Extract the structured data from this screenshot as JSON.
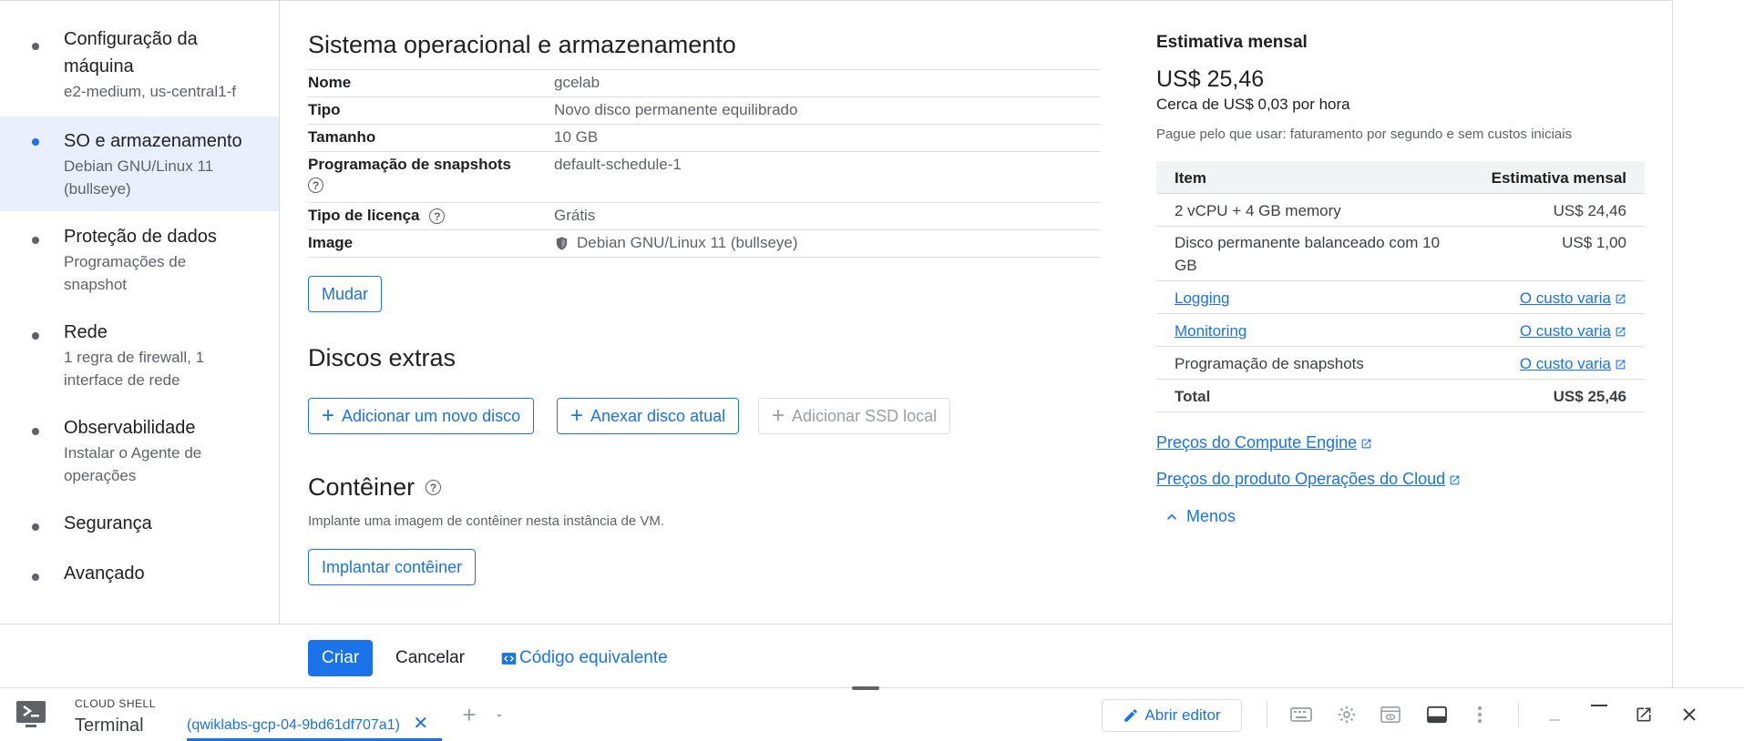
{
  "nav": {
    "items": [
      {
        "title": "Configuração da máquina",
        "sub": "e2-medium, us-central1-f"
      },
      {
        "title": "SO e armazenamento",
        "sub": "Debian GNU/Linux 11 (bullseye)"
      },
      {
        "title": "Proteção de dados",
        "sub": "Programações de snapshot"
      },
      {
        "title": "Rede",
        "sub": "1 regra de firewall, 1 interface de rede"
      },
      {
        "title": "Observabilidade",
        "sub": "Instalar o Agente de operações"
      },
      {
        "title": "Segurança",
        "sub": ""
      },
      {
        "title": "Avançado",
        "sub": ""
      }
    ],
    "active_index": 1
  },
  "os_section": {
    "title": "Sistema operacional e armazenamento",
    "rows": [
      {
        "key": "Nome",
        "value": "gcelab"
      },
      {
        "key": "Tipo",
        "value": "Novo disco permanente equilibrado"
      },
      {
        "key": "Tamanho",
        "value": "10 GB"
      },
      {
        "key": "Programação de snapshots",
        "value": "default-schedule-1"
      },
      {
        "key": "Tipo de licença",
        "value": "Grátis"
      },
      {
        "key": "Image",
        "value": "Debian GNU/Linux 11 (bullseye)"
      }
    ],
    "change_button": "Mudar"
  },
  "disks_section": {
    "title": "Discos extras",
    "add_new": "Adicionar um novo disco",
    "attach_existing": "Anexar disco atual",
    "add_local_ssd": "Adicionar SSD local"
  },
  "container_section": {
    "title": "Contêiner",
    "description": "Implante uma imagem de contêiner nesta instância de VM.",
    "deploy_button": "Implantar contêiner"
  },
  "estimate": {
    "title": "Estimativa mensal",
    "price": "US$ 25,46",
    "hourly": "Cerca de US$ 0,03 por hora",
    "note": "Pague pelo que usar: faturamento por segundo e sem custos iniciais",
    "header": {
      "item": "Item",
      "cost": "Estimativa mensal"
    },
    "rows": [
      {
        "item": "2 vCPU + 4 GB memory",
        "cost": "US$ 24,46",
        "item_link": false,
        "cost_link": false
      },
      {
        "item": "Disco permanente balanceado com 10 GB",
        "cost": "US$ 1,00",
        "item_link": false,
        "cost_link": false
      },
      {
        "item": "Logging",
        "cost": "O custo varia",
        "item_link": true,
        "cost_link": true
      },
      {
        "item": "Monitoring",
        "cost": "O custo varia",
        "item_link": true,
        "cost_link": true
      },
      {
        "item": "Programação de snapshots",
        "cost": "O custo varia",
        "item_link": false,
        "cost_link": true
      }
    ],
    "total": {
      "item": "Total",
      "cost": "US$ 25,46"
    },
    "links": [
      "Preços do Compute Engine",
      "Preços do produto Operações do Cloud"
    ],
    "less": "Menos"
  },
  "footer": {
    "create": "Criar",
    "cancel": "Cancelar",
    "equivalent_code": "Código equivalente"
  },
  "shell": {
    "caption": "CLOUD SHELL",
    "title": "Terminal",
    "tab_label": "(qwiklabs-gcp-04-9bd61df707a1)",
    "open_editor": "Abrir editor"
  },
  "colors": {
    "accent": "#1a73e8",
    "active_nav_bg": "#e8f0fe",
    "border": "#dadce0"
  }
}
